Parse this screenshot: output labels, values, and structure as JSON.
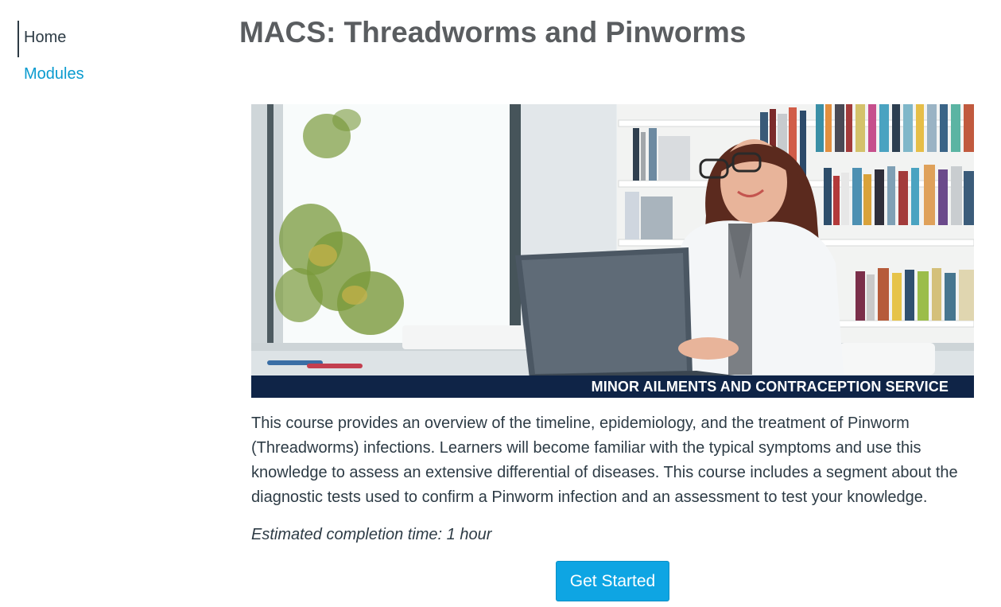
{
  "nav": {
    "items": [
      {
        "label": "Home",
        "active": true
      },
      {
        "label": "Modules",
        "active": false
      }
    ]
  },
  "page": {
    "title": "MACS: Threadworms and Pinworms"
  },
  "banner": {
    "caption": "MINOR AILMENTS AND CONTRACEPTION SERVICE",
    "caption_bg": "#0f2447"
  },
  "content": {
    "description": "This course provides an overview of the timeline, epidemiology, and the treatment of Pinworm (Threadworms) infections. Learners will become familiar with the typical symptoms and use this knowledge to assess an extensive differential of diseases. This course includes a segment about the diagnostic tests used to confirm a Pinworm infection and an assessment to test your knowledge.",
    "estimate": "Estimated completion time: 1 hour",
    "cta_label": "Get Started"
  },
  "colors": {
    "link": "#0a9bcf",
    "button": "#0ea5e3",
    "title": "#5a5d60",
    "text": "#2d3b45"
  }
}
